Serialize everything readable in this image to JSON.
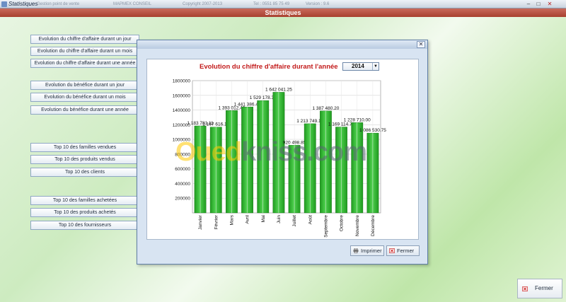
{
  "app": {
    "title": "Statistiques",
    "meta": [
      "Gestion point de vente",
      "MAPMEX CONSEIL",
      "Copyright 2007-2013",
      "Tel : 0551 85 75 49",
      "Version : 9.6"
    ]
  },
  "heading": "Statistiques",
  "menu": [
    "Evolution du chiffre d'affaire durant un jour",
    "Evolution du chiffre d'affaire durant un mois",
    "Evolution du chiffre d'affaire durant une année",
    "Evolution du bénéfice durant un jour",
    "Evolution du bénéfice durant un mois",
    "Evolution du bénéfice durant une année",
    "Top 10 des familles vendues",
    "Top 10 des produits vendus",
    "Top 10 des clients",
    "Top 10 des familles achetées",
    "Top 10 des produits achetés",
    "Top 10 des fournisseurs"
  ],
  "modal": {
    "year": "2014",
    "print_label": "Imprimer",
    "close_label": "Fermer"
  },
  "bottom_close_label": "Fermer",
  "watermark": {
    "part1": "Oued",
    "part2": "kniss",
    "part3": ".com"
  },
  "colors": {
    "bar": "#1f9a1f",
    "bar_light": "#4fd14f",
    "title": "#c21a1a",
    "heading": "#b04a3a"
  },
  "chart_data": {
    "type": "bar",
    "title": "Evolution du chiffre d'affaire durant l'année",
    "categories": [
      "Janvier",
      "Février",
      "Mars",
      "Avril",
      "Mai",
      "Juin",
      "Juillet",
      "Août",
      "Septembre",
      "Octobre",
      "Novembre",
      "Décembre"
    ],
    "values": [
      1183781.11,
      1167616.1,
      1393012.4,
      1441386.41,
      1529178.3,
      1642041.25,
      920498.85,
      1213749.15,
      1387480.2,
      1169114.7,
      1228710,
      1086530.75
    ],
    "data_labels": [
      "1 183 781.11",
      "1 167 616.10",
      "1 393 012.40",
      "1 441 386.41",
      "1 529 178.30",
      "1 642 041.25",
      "920 498.85",
      "1 213 749.15",
      "1 387 480.20",
      "1 169 114.70",
      "1 228 710.00",
      "1 086 530.75"
    ],
    "ylim": [
      0,
      1800000
    ],
    "yticks": [
      200000,
      400000,
      600000,
      800000,
      1000000,
      1200000,
      1400000,
      1600000,
      1800000
    ],
    "grid": true
  }
}
